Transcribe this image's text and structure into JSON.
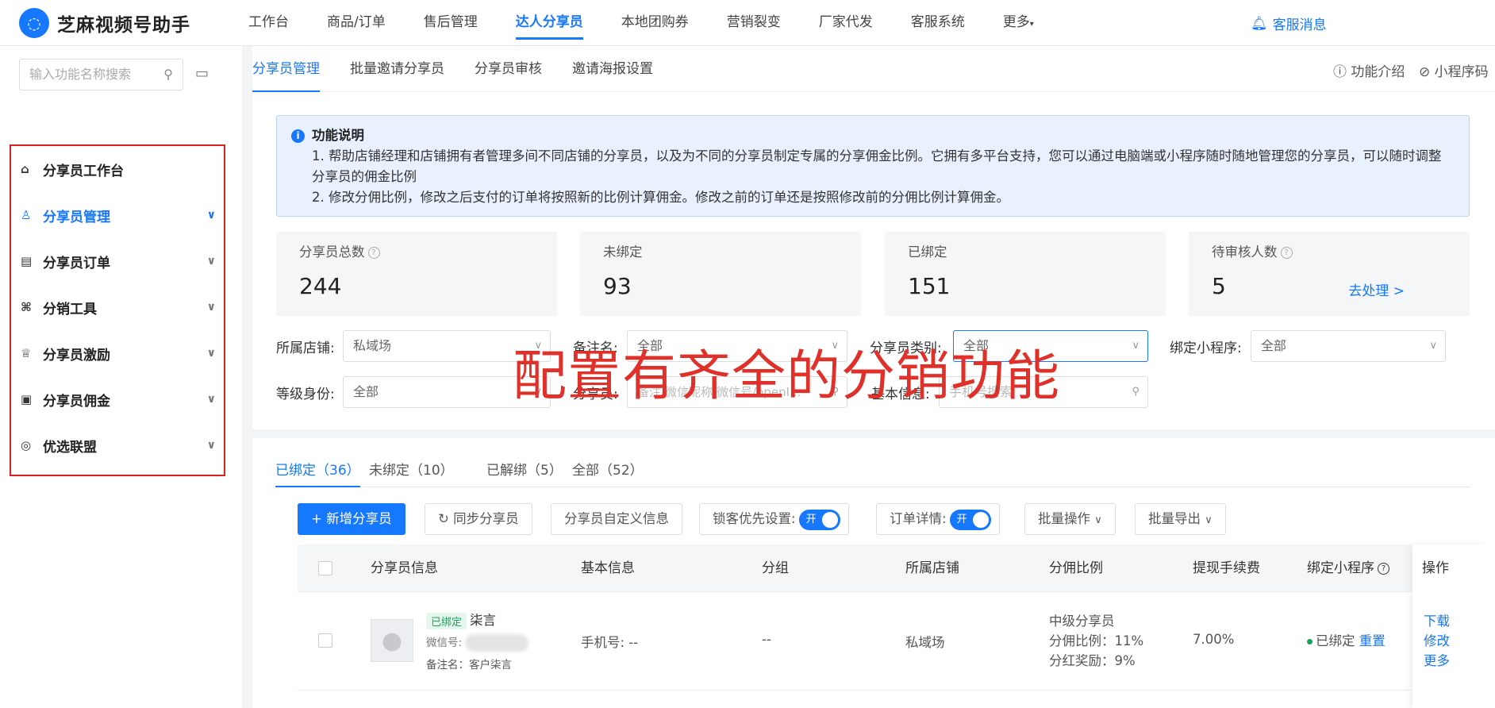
{
  "app": {
    "title": "芝麻视频号助手",
    "logo_icon": "chat-bubble-icon"
  },
  "nav": {
    "items": [
      "工作台",
      "商品/订单",
      "售后管理",
      "达人分享员",
      "本地团购券",
      "营销裂变",
      "厂家代发",
      "客服系统",
      "更多"
    ],
    "active": "达人分享员",
    "service": "客服消息"
  },
  "sidebar": {
    "search_placeholder": "输入功能名称搜索",
    "items": [
      {
        "label": "分享员工作台",
        "icon": "home-icon"
      },
      {
        "label": "分享员管理",
        "icon": "users-icon",
        "active": true
      },
      {
        "label": "分享员订单",
        "icon": "order-icon"
      },
      {
        "label": "分销工具",
        "icon": "tool-icon"
      },
      {
        "label": "分享员激励",
        "icon": "trophy-icon"
      },
      {
        "label": "分享员佣金",
        "icon": "commission-icon"
      },
      {
        "label": "优选联盟",
        "icon": "alliance-icon"
      }
    ]
  },
  "subtabs": {
    "items": [
      "分享员管理",
      "批量邀请分享员",
      "分享员审核",
      "邀请海报设置"
    ],
    "right": [
      "功能介绍",
      "小程序码"
    ]
  },
  "info": {
    "title": "功能说明",
    "line1": "1. 帮助店铺经理和店铺拥有者管理多间不同店铺的分享员，以及为不同的分享员制定专属的分享佣金比例。它拥有多平台支持，您可以通过电脑端或小程序随时随地管理您的分享员，可以随时调整分享员的佣金比例",
    "line2": "2. 修改分佣比例，修改之后支付的订单将按照新的比例计算佣金。修改之前的订单还是按照修改前的分佣比例计算佣金。"
  },
  "stats": [
    {
      "label": "分享员总数",
      "value": "244"
    },
    {
      "label": "未绑定",
      "value": "93"
    },
    {
      "label": "已绑定",
      "value": "151"
    },
    {
      "label": "待审核人数",
      "value": "5",
      "link": "去处理 >"
    }
  ],
  "filters": {
    "store_label": "所属店铺:",
    "store_value": "私域场",
    "remark_label": "备注名:",
    "remark_value": "全部",
    "type_label": "分享员类别:",
    "type_value": "全部",
    "mini_label": "绑定小程序:",
    "mini_value": "全部",
    "level_label": "等级身份:",
    "level_value": "全部",
    "sharer_label": "分享员:",
    "sharer_placeholder": "备注/微信昵称/微信号/openI...",
    "basic_label": "基本信息:",
    "basic_placeholder": "手机号搜索"
  },
  "overlay_text": "配置有齐全的分销功能",
  "list_tabs": [
    "已绑定（36）",
    "未绑定（10）",
    "已解绑（5）",
    "全部（52）"
  ],
  "toolbar": {
    "add": "+ 新增分享员",
    "sync": "同步分享员",
    "custom": "分享员自定义信息",
    "lock": "锁客优先设置:",
    "order": "订单详情:",
    "toggle_on": "开",
    "batch": "批量操作",
    "export": "批量导出"
  },
  "table": {
    "headers": [
      "分享员信息",
      "基本信息",
      "分组",
      "所属店铺",
      "分佣比例",
      "提现手续费",
      "绑定小程序",
      "操作"
    ],
    "row": {
      "tag": "已绑定",
      "name": "柒言",
      "wechat_label": "微信号:",
      "remark": "备注名：客户柒言",
      "phone": "手机号: --",
      "group": "--",
      "store": "私域场",
      "level": "中级分享员",
      "ratio": "分佣比例：11%",
      "bonus": "分红奖励：9%",
      "fee": "7.00%",
      "bind_status": "已绑定",
      "reset": "重置",
      "ops": [
        "下载",
        "修改",
        "更多"
      ]
    }
  },
  "colors": {
    "accent": "#1677ff",
    "annotation": "#e0302a",
    "success": "#1aa35b"
  }
}
